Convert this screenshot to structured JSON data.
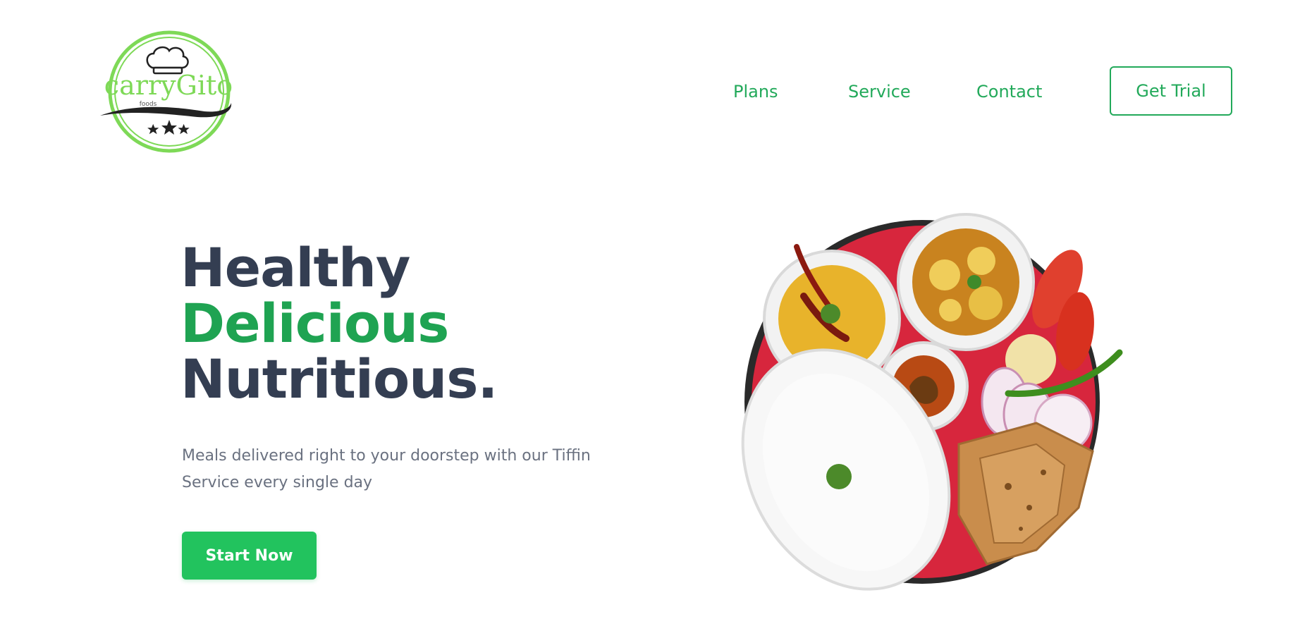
{
  "brand": {
    "name": "carryGito",
    "tagline": "foods"
  },
  "nav": {
    "items": [
      {
        "label": "Plans"
      },
      {
        "label": "Service"
      },
      {
        "label": "Contact"
      }
    ],
    "cta_label": "Get Trial"
  },
  "hero": {
    "title_line1": "Healthy",
    "title_line2": "Delicious",
    "title_line3": "Nutritious.",
    "subtitle": "Meals delivered right to your doorstep with our Tiffin Service every single day",
    "cta_label": "Start Now"
  },
  "colors": {
    "accent": "#22a95a",
    "button": "#22c35e",
    "heading": "#343e52",
    "body_text": "#6a7180",
    "logo_ring": "#7ed957"
  }
}
